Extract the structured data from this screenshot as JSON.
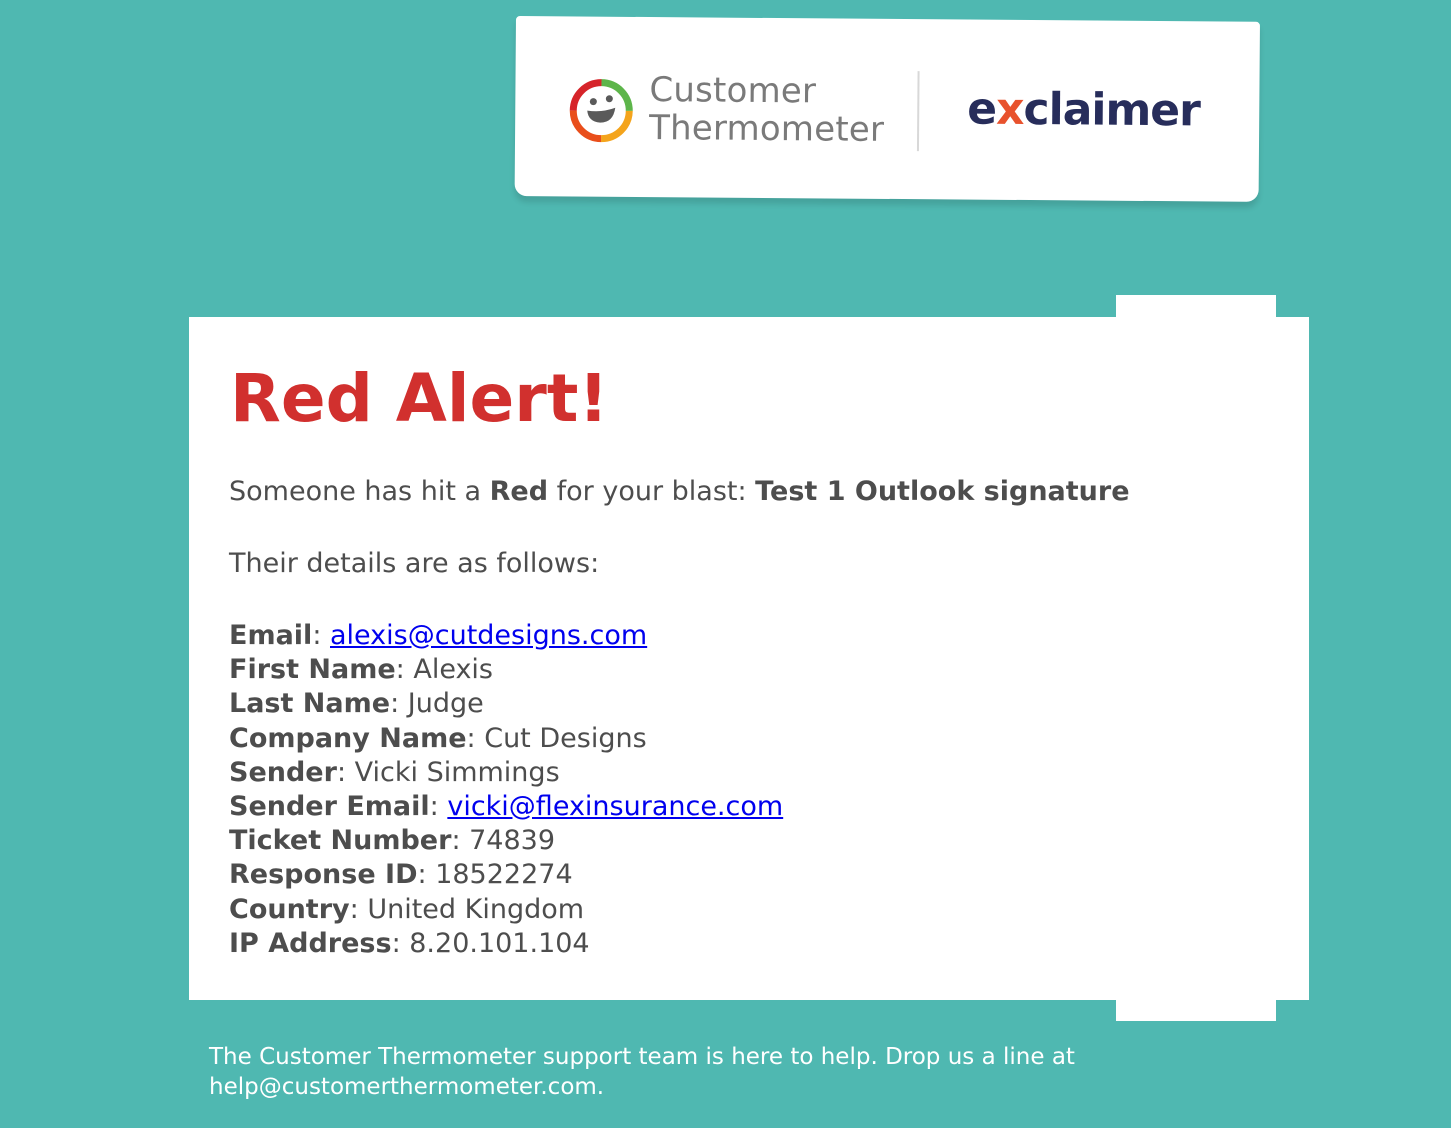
{
  "header": {
    "brand_left_line1": "Customer",
    "brand_left_line2": "Thermometer",
    "brand_right_prefix": "e",
    "brand_right_accent": "x",
    "brand_right_suffix": "claimer"
  },
  "alert": {
    "title": "Red Alert!",
    "intro_prefix": "Someone has hit a ",
    "intro_rating": "Red",
    "intro_middle": " for your blast: ",
    "intro_blast": "Test 1 Outlook signature",
    "details_intro": "Their details are as follows:"
  },
  "details": [
    {
      "label": "Email",
      "value": "alexis@cutdesigns.com",
      "is_link": true
    },
    {
      "label": "First Name",
      "value": "Alexis",
      "is_link": false
    },
    {
      "label": "Last Name",
      "value": "Judge",
      "is_link": false
    },
    {
      "label": "Company Name",
      "value": "Cut Designs",
      "is_link": false
    },
    {
      "label": "Sender",
      "value": "Vicki Simmings",
      "is_link": false
    },
    {
      "label": "Sender Email",
      "value": "vicki@flexinsurance.com",
      "is_link": true
    },
    {
      "label": "Ticket Number",
      "value": "74839",
      "is_link": false
    },
    {
      "label": "Response ID",
      "value": "18522274",
      "is_link": false
    },
    {
      "label": "Country",
      "value": "United Kingdom",
      "is_link": false
    },
    {
      "label": "IP Address",
      "value": "8.20.101.104",
      "is_link": false
    }
  ],
  "separator": ": ",
  "footer": {
    "line1": "The Customer Thermometer support team is here to help. Drop us a line at",
    "line2": "help@customerthermometer.com."
  },
  "colors": {
    "background": "#4fb8b1",
    "alert_red": "#d1302e",
    "link_blue": "#0000ee",
    "body_text": "#4d4d4d"
  },
  "icons": {
    "brand_mark": "customer-thermometer-smiley-ring-icon"
  }
}
